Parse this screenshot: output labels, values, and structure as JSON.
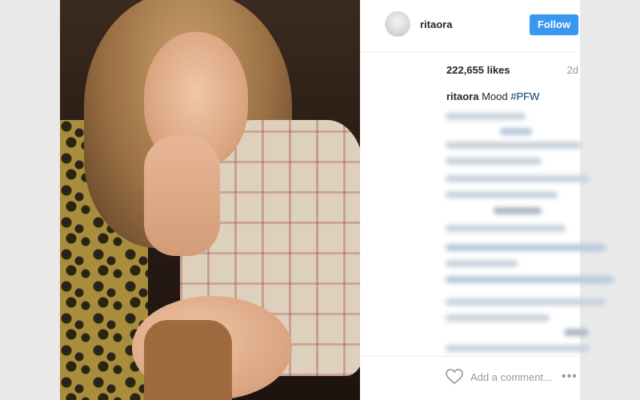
{
  "post": {
    "photo_alt": "Woman in plaid jacket resting chin on hand",
    "username": "ritaora",
    "follow_label": "Follow",
    "likes": "222,655 likes",
    "timestamp": "2d",
    "caption": {
      "user": "ritaora",
      "text": " Mood ",
      "hashtag": "#PFW"
    },
    "comment_placeholder": "Add a comment...",
    "more_label": "•••"
  },
  "colors": {
    "accent": "#3897f0",
    "hashtag": "#003569",
    "muted": "#999999"
  },
  "icons": {
    "like": "heart-icon",
    "more": "more-options-icon",
    "avatar": "avatar"
  }
}
